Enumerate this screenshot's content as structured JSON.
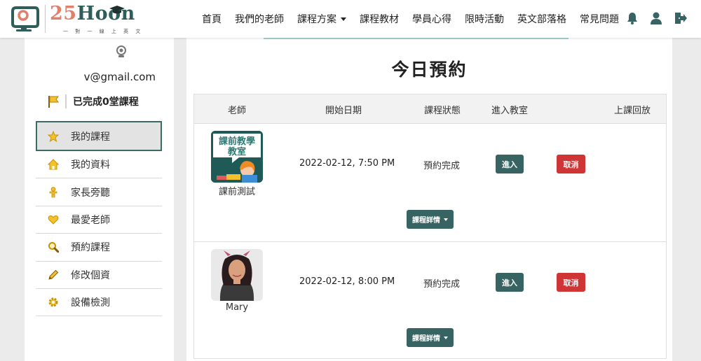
{
  "brand": {
    "num": "25",
    "word": "Hoon",
    "subtitle": "一 對 一 線 上 英 文"
  },
  "nav": {
    "items": [
      "首頁",
      "我們的老師",
      "課程方案",
      "課程教材",
      "學員心得",
      "限時活動",
      "英文部落格",
      "常見問題"
    ],
    "dropdown_item_index": 2,
    "icons": [
      "bell-icon",
      "user-icon",
      "logout-icon"
    ]
  },
  "sidebar": {
    "email": "v@gmail.com",
    "progress": "已完成0堂課程",
    "menu": [
      {
        "label": "我的課程",
        "icon": "star-icon",
        "active": true
      },
      {
        "label": "我的資料",
        "icon": "home-icon"
      },
      {
        "label": "家長旁聽",
        "icon": "person-icon"
      },
      {
        "label": "最愛老師",
        "icon": "heart-icon"
      },
      {
        "label": "預約課程",
        "icon": "search-icon"
      },
      {
        "label": "修改個資",
        "icon": "pencil-icon"
      },
      {
        "label": "設備檢測",
        "icon": "gear-icon"
      }
    ]
  },
  "main": {
    "title": "今日預約",
    "columns": [
      "老師",
      "開始日期",
      "課程狀態",
      "進入教室",
      "上課回放"
    ],
    "rows": [
      {
        "avatar_text": "課前教學教室",
        "teacher": "課前測試",
        "date": "2022-02-12, 7:50 PM",
        "status": "預約完成",
        "enter": "進入",
        "cancel": "取消",
        "detail": "課程詳情"
      },
      {
        "teacher": "Mary",
        "date": "2022-02-12, 8:00 PM",
        "status": "預約完成",
        "enter": "進入",
        "cancel": "取消",
        "detail": "課程詳情"
      }
    ]
  },
  "colors": {
    "primary": "#376462",
    "danger": "#d03535",
    "accent": "#e07f6c",
    "icon_yellow": "#f2c12e"
  }
}
